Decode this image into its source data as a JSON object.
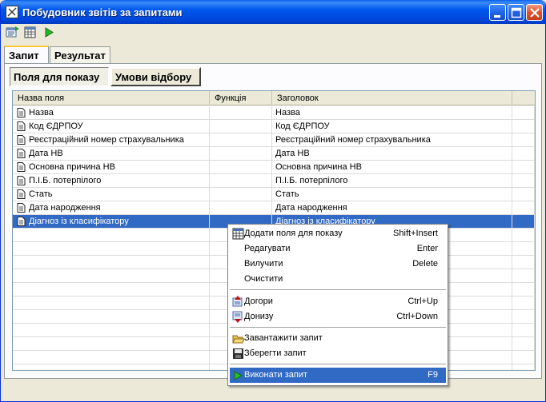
{
  "window": {
    "title": "Побудовник звітів за запитами"
  },
  "toolbar": {
    "icons": [
      "report-icon",
      "table-icon",
      "run-icon"
    ]
  },
  "tabs": [
    {
      "label": "Запит",
      "active": true
    },
    {
      "label": "Результат",
      "active": false
    }
  ],
  "subtabs": [
    {
      "label": "Поля для показу",
      "active": true
    },
    {
      "label": "Умови відбору",
      "active": false
    }
  ],
  "grid": {
    "columns": [
      "Назва поля",
      "Функція",
      "Заголовок"
    ],
    "rows": [
      {
        "field": "Назва",
        "func": "",
        "caption": "Назва"
      },
      {
        "field": "Код ЄДРПОУ",
        "func": "",
        "caption": "Код ЄДРПОУ"
      },
      {
        "field": "Реєстраційний номер страхувальника",
        "func": "",
        "caption": "Реєстраційний номер страхувальника"
      },
      {
        "field": "Дата НВ",
        "func": "",
        "caption": "Дата НВ"
      },
      {
        "field": "Основна причина НВ",
        "func": "",
        "caption": "Основна причина НВ"
      },
      {
        "field": "П.І.Б. потерпілого",
        "func": "",
        "caption": "П.І.Б. потерпілого"
      },
      {
        "field": "Стать",
        "func": "",
        "caption": "Стать"
      },
      {
        "field": "Дата народження",
        "func": "",
        "caption": "Дата народження"
      },
      {
        "field": "Діагноз із класифікатору",
        "func": "",
        "caption": "Діагноз із класифікатору",
        "selected": true
      }
    ]
  },
  "context_menu": {
    "items": [
      {
        "label": "Додати поля для показу",
        "shortcut": "Shift+Insert",
        "icon": "table-add-icon"
      },
      {
        "label": "Редагувати",
        "shortcut": "Enter"
      },
      {
        "label": "Вилучити",
        "shortcut": "Delete"
      },
      {
        "label": "Очистити",
        "shortcut": ""
      },
      {
        "label": "Догори",
        "shortcut": "Ctrl+Up",
        "icon": "move-up-icon"
      },
      {
        "label": "Донизу",
        "shortcut": "Ctrl+Down",
        "icon": "move-down-icon"
      },
      {
        "label": "Завантажити запит",
        "shortcut": "",
        "icon": "open-folder-icon"
      },
      {
        "label": "Зберегти запит",
        "shortcut": "",
        "icon": "save-disk-icon"
      },
      {
        "label": "Виконати запит",
        "shortcut": "F9",
        "icon": "run-icon",
        "highlighted": true
      }
    ]
  },
  "colors": {
    "titlebar": "#0054e3",
    "selection": "#316ac5",
    "tab_accent": "#ffc83c",
    "window_bg": "#ece9d8"
  }
}
